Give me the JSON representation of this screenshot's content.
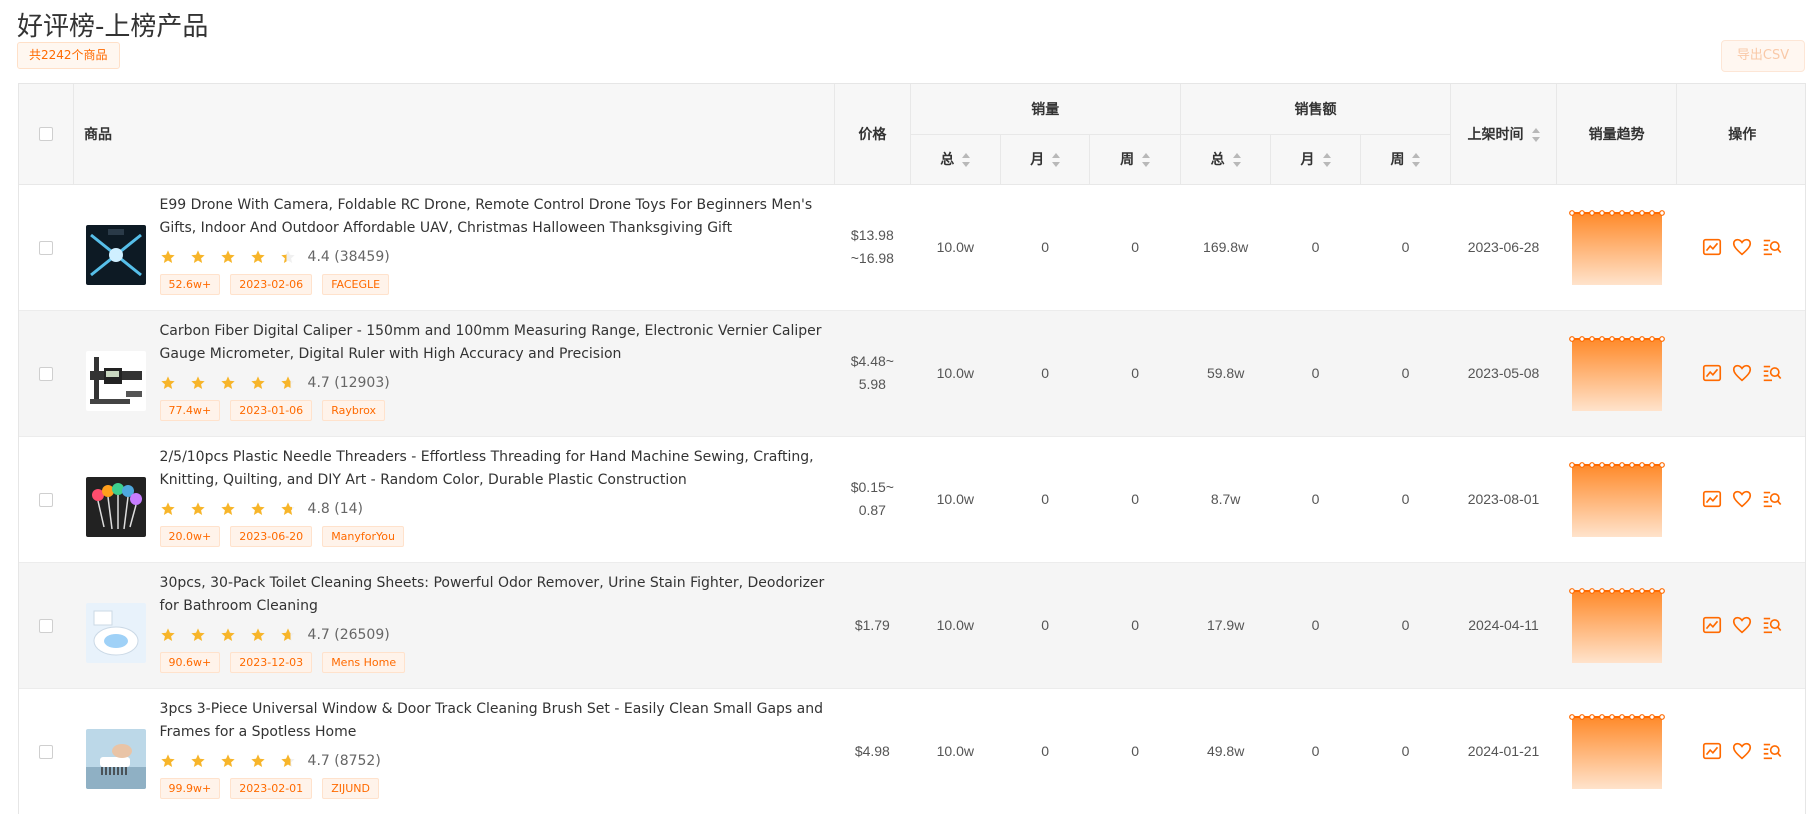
{
  "page": {
    "title": "好评榜-上榜产品",
    "count_badge": "共2242个商品",
    "export_label": "导出CSV"
  },
  "colors": {
    "accent": "#ff6a00",
    "star": "#f7b52a"
  },
  "table": {
    "headers": {
      "product": "商品",
      "price": "价格",
      "sales": "销量",
      "revenue": "销售额",
      "listed": "上架时间",
      "trend": "销量趋势",
      "actions": "操作",
      "total": "总",
      "month": "月",
      "week": "周"
    },
    "rows": [
      {
        "title": "E99 Drone With Camera, Foldable RC Drone, Remote Control Drone Toys For Beginners Men's Gifts, Indoor And Outdoor Affordable UAV, Christmas Halloween Thanksgiving Gift",
        "rating": 4.4,
        "rating_text": "4.4 (38459)",
        "tags": [
          "52.6w+",
          "2023-02-06",
          "FACEGLE"
        ],
        "price_line1": "$13.98",
        "price_line2": "~16.98",
        "sales_total": "10.0w",
        "sales_month": "0",
        "sales_week": "0",
        "rev_total": "169.8w",
        "rev_month": "0",
        "rev_week": "0",
        "listed": "2023-06-28",
        "thumb": "drone"
      },
      {
        "title": "Carbon Fiber Digital Caliper - 150mm and 100mm Measuring Range, Electronic Vernier Caliper Gauge Micrometer, Digital Ruler with High Accuracy and Precision",
        "rating": 4.7,
        "rating_text": "4.7 (12903)",
        "tags": [
          "77.4w+",
          "2023-01-06",
          "Raybrox"
        ],
        "price_line1": "$4.48~",
        "price_line2": "5.98",
        "sales_total": "10.0w",
        "sales_month": "0",
        "sales_week": "0",
        "rev_total": "59.8w",
        "rev_month": "0",
        "rev_week": "0",
        "listed": "2023-05-08",
        "thumb": "caliper"
      },
      {
        "title": "2/5/10pcs Plastic Needle Threaders - Effortless Threading for Hand Machine Sewing, Crafting, Knitting, Quilting, and DIY Art - Random Color, Durable Plastic Construction",
        "rating": 4.8,
        "rating_text": "4.8 (14)",
        "tags": [
          "20.0w+",
          "2023-06-20",
          "ManyforYou"
        ],
        "price_line1": "$0.15~",
        "price_line2": "0.87",
        "sales_total": "10.0w",
        "sales_month": "0",
        "sales_week": "0",
        "rev_total": "8.7w",
        "rev_month": "0",
        "rev_week": "0",
        "listed": "2023-08-01",
        "thumb": "threader"
      },
      {
        "title": "30pcs, 30-Pack Toilet Cleaning Sheets: Powerful Odor Remover, Urine Stain Fighter, Deodorizer for Bathroom Cleaning",
        "rating": 4.7,
        "rating_text": "4.7 (26509)",
        "tags": [
          "90.6w+",
          "2023-12-03",
          "Mens Home"
        ],
        "price_line1": "$1.79",
        "price_line2": "",
        "sales_total": "10.0w",
        "sales_month": "0",
        "sales_week": "0",
        "rev_total": "17.9w",
        "rev_month": "0",
        "rev_week": "0",
        "listed": "2024-04-11",
        "thumb": "toilet"
      },
      {
        "title": "3pcs 3-Piece Universal Window & Door Track Cleaning Brush Set - Easily Clean Small Gaps and Frames for a Spotless Home",
        "rating": 4.7,
        "rating_text": "4.7 (8752)",
        "tags": [
          "99.9w+",
          "2023-02-01",
          "ZIJUND"
        ],
        "price_line1": "$4.98",
        "price_line2": "",
        "sales_total": "10.0w",
        "sales_month": "0",
        "sales_week": "0",
        "rev_total": "49.8w",
        "rev_month": "0",
        "rev_week": "0",
        "listed": "2024-01-21",
        "thumb": "brush"
      }
    ]
  },
  "icons": {
    "trend": "trend-chart-icon",
    "favorite": "heart-icon",
    "detail": "search-list-icon"
  }
}
